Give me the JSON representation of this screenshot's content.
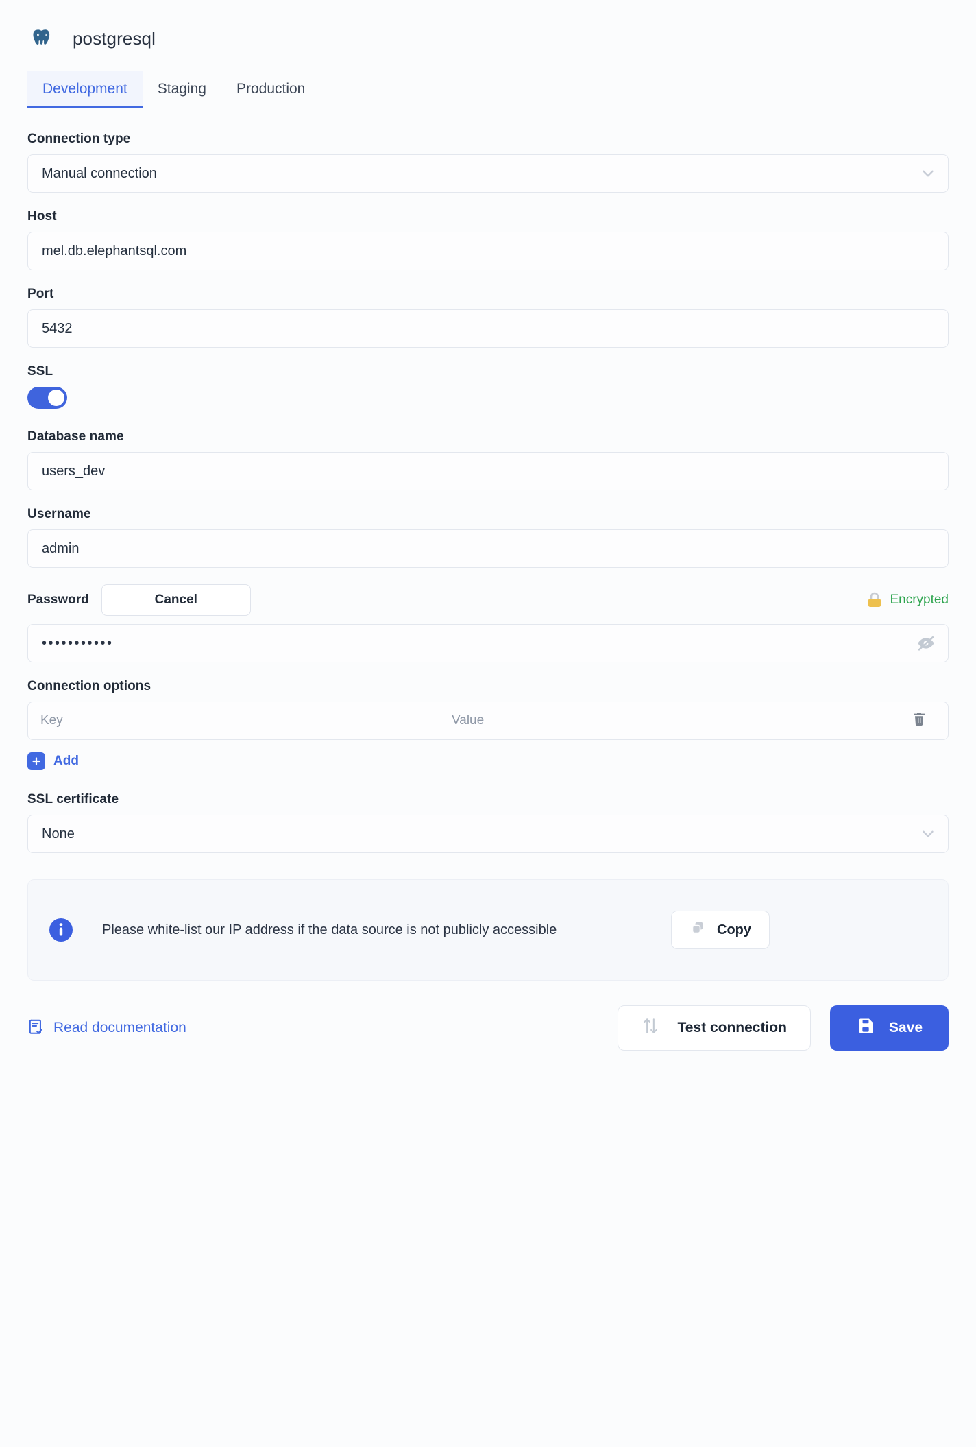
{
  "header": {
    "title": "postgresql",
    "logo_icon": "postgres-elephant-icon"
  },
  "tabs": [
    {
      "label": "Development",
      "active": true
    },
    {
      "label": "Staging",
      "active": false
    },
    {
      "label": "Production",
      "active": false
    }
  ],
  "form": {
    "connection_type": {
      "label": "Connection type",
      "value": "Manual connection",
      "icon": "chevron-down-icon"
    },
    "host": {
      "label": "Host",
      "value": "mel.db.elephantsql.com"
    },
    "port": {
      "label": "Port",
      "value": "5432"
    },
    "ssl": {
      "label": "SSL",
      "enabled": true
    },
    "database_name": {
      "label": "Database name",
      "value": "users_dev"
    },
    "username": {
      "label": "Username",
      "value": "admin"
    },
    "password": {
      "label": "Password",
      "cancel_label": "Cancel",
      "encrypted_label": "Encrypted",
      "encrypted_color": "#2da44e",
      "lock_icon": "lock-icon",
      "value": "•••••••••••",
      "reveal_icon": "eye-off-icon"
    },
    "connection_options": {
      "label": "Connection options",
      "columns": [
        "Key",
        "Value"
      ],
      "rows": [],
      "delete_icon": "trash-icon",
      "add_label": "Add",
      "add_icon": "plus-icon"
    },
    "ssl_certificate": {
      "label": "SSL certificate",
      "value": "None",
      "icon": "chevron-down-icon"
    }
  },
  "info_panel": {
    "icon": "info-icon",
    "message": "Please white-list our IP address if the data source is not publicly accessible",
    "copy_label": "Copy",
    "copy_icon": "copy-icon"
  },
  "footer": {
    "doc_link_label": "Read documentation",
    "doc_link_icon": "document-check-icon",
    "test_label": "Test connection",
    "test_icon": "arrows-up-down-icon",
    "save_label": "Save",
    "save_icon": "floppy-disk-icon"
  },
  "colors": {
    "accent": "#4169e1",
    "save_button": "#3b5fe0",
    "success": "#2da44e",
    "page_bg": "#fbfcfd"
  }
}
